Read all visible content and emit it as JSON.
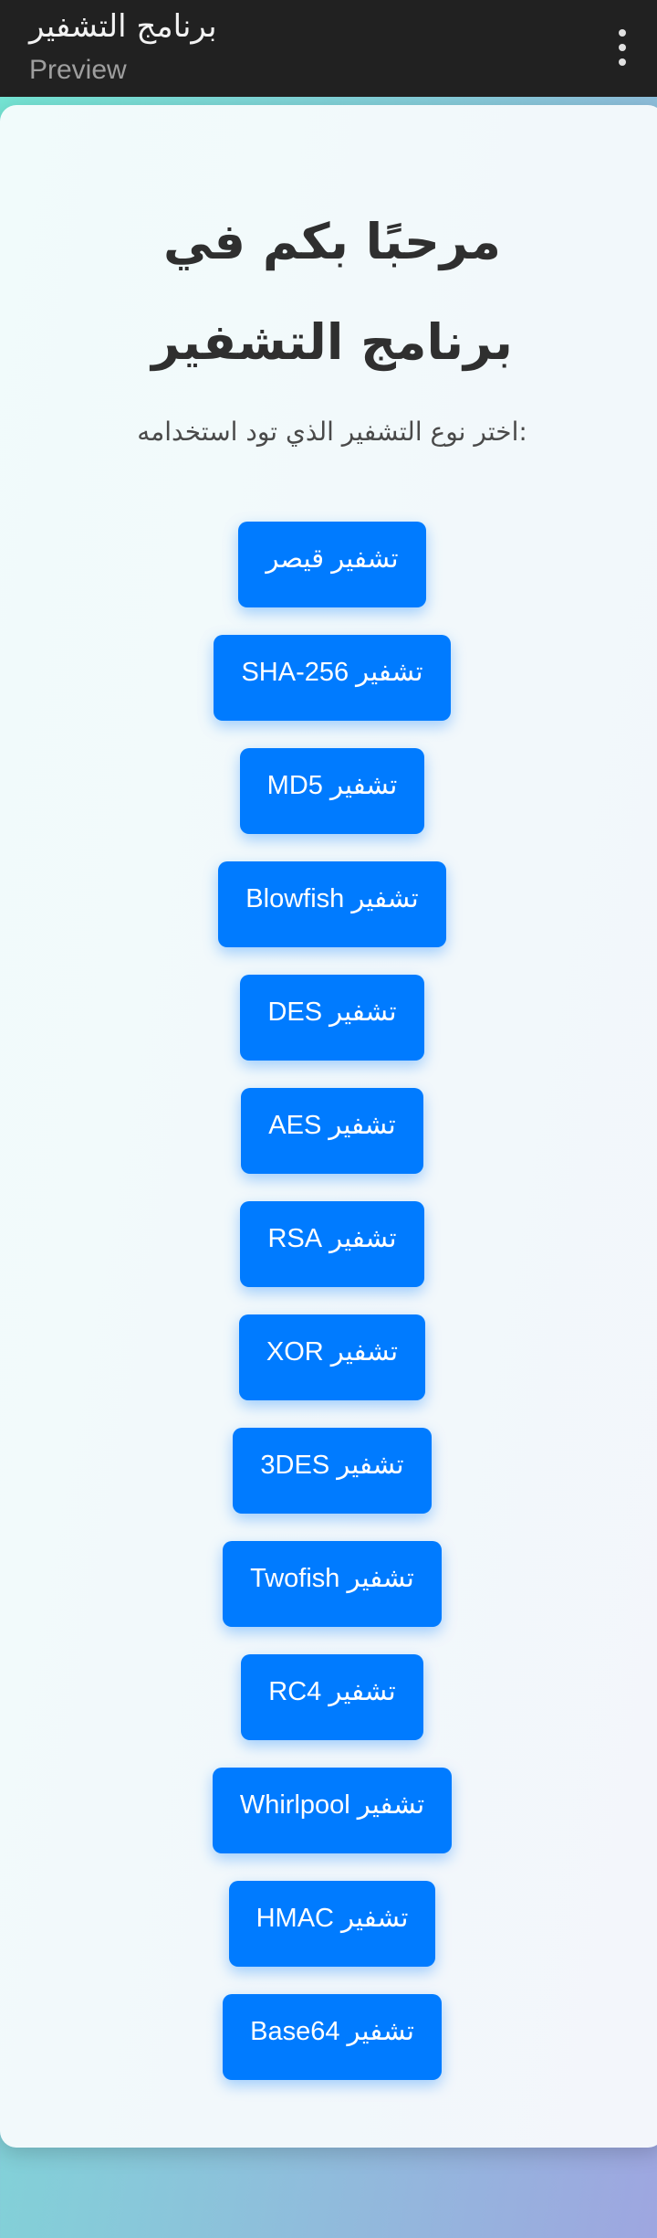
{
  "appbar": {
    "title": "برنامج التشفير",
    "subtitle": "Preview",
    "menu_icon": "more-vert-icon"
  },
  "main": {
    "heading": "مرحبًا بكم في برنامج التشفير",
    "subheading": "اختر نوع التشفير الذي تود استخدامه:",
    "buttons": [
      {
        "label": "تشفير قيصر"
      },
      {
        "label": "تشفير SHA-256"
      },
      {
        "label": "تشفير MD5"
      },
      {
        "label": "تشفير Blowfish"
      },
      {
        "label": "تشفير DES"
      },
      {
        "label": "تشفير AES"
      },
      {
        "label": "تشفير RSA"
      },
      {
        "label": "تشفير XOR"
      },
      {
        "label": "تشفير 3DES"
      },
      {
        "label": "تشفير Twofish"
      },
      {
        "label": "تشفير RC4"
      },
      {
        "label": "تشفير Whirlpool"
      },
      {
        "label": "تشفير HMAC"
      },
      {
        "label": "تشفير Base64"
      }
    ]
  },
  "colors": {
    "appbar_bg": "#212121",
    "button_bg": "#007bff",
    "button_text": "#ffffff",
    "heading_text": "#2f2f2f",
    "background_gradient_start": "#74e6d4",
    "background_gradient_end": "#9ea6e0"
  }
}
